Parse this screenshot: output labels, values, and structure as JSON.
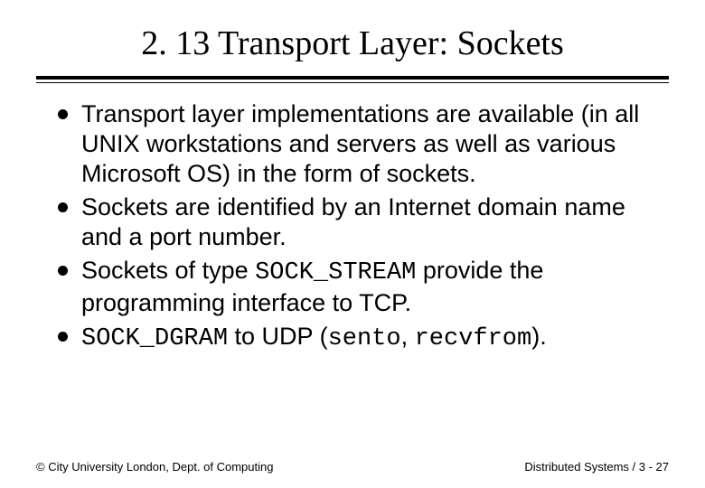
{
  "title": "2. 13 Transport Layer: Sockets",
  "bullets": [
    {
      "segments": [
        {
          "text": "Transport layer implementations are available (in all UNIX workstations and servers as well as various Microsoft OS) in the form of sockets.",
          "mono": false
        }
      ]
    },
    {
      "segments": [
        {
          "text": "Sockets are identified by an Internet domain name and a port number.",
          "mono": false
        }
      ]
    },
    {
      "segments": [
        {
          "text": "Sockets of type ",
          "mono": false
        },
        {
          "text": "SOCK_STREAM",
          "mono": true
        },
        {
          "text": " provide the programming interface to TCP.",
          "mono": false
        }
      ]
    },
    {
      "segments": [
        {
          "text": "SOCK_DGRAM",
          "mono": true
        },
        {
          "text": " to UDP (",
          "mono": false
        },
        {
          "text": "sento",
          "mono": true
        },
        {
          "text": ", ",
          "mono": false
        },
        {
          "text": "recvfrom",
          "mono": true
        },
        {
          "text": ").",
          "mono": false
        }
      ]
    }
  ],
  "footer": {
    "left": "© City University London, Dept. of Computing",
    "right": "Distributed Systems / 3 - 27"
  }
}
